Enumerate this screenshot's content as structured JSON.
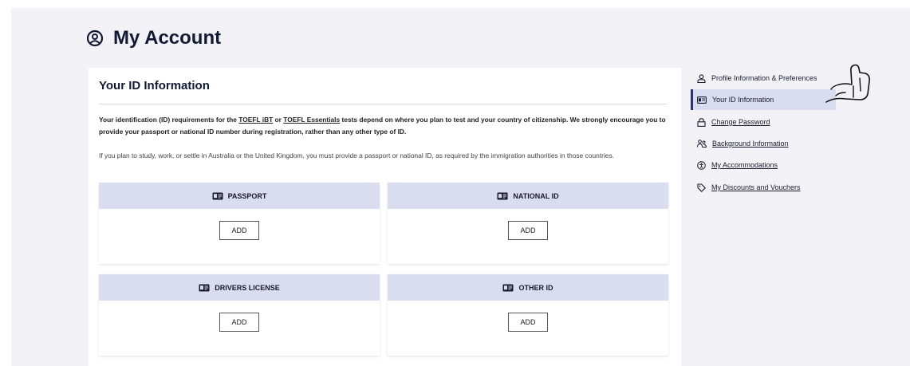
{
  "page": {
    "title": "My Account",
    "title_icon": "user-circle-icon"
  },
  "id_card": {
    "heading": "Your ID Information",
    "para1": {
      "before": "Your identification (ID) requirements for the ",
      "link1": "TOEFL iBT",
      "mid": " or ",
      "link2": "TOEFL Essentials",
      "after": " tests depend on where you plan to test and your country of citizenship. We strongly encourage you to provide your passport or national ID number during registration, rather than any other type of ID."
    },
    "para2": "If you plan to study, work, or settle in Australia or the United Kingdom, you must provide a passport or national ID, as required by the immigration authorities in those countries.",
    "id_types": [
      {
        "label": "PASSPORT",
        "button": "ADD"
      },
      {
        "label": "NATIONAL ID",
        "button": "ADD"
      },
      {
        "label": "DRIVERS LICENSE",
        "button": "ADD"
      },
      {
        "label": "OTHER ID",
        "button": "ADD"
      }
    ]
  },
  "sidebar": {
    "items": [
      {
        "label": "Profile Information & Preferences",
        "icon": "person-icon",
        "active": false,
        "underlined": false
      },
      {
        "label": "Your ID Information",
        "icon": "id-card-icon",
        "active": true,
        "underlined": false
      },
      {
        "label": "Change Password",
        "icon": "lock-icon",
        "active": false,
        "underlined": true
      },
      {
        "label": "Background Information",
        "icon": "people-icon",
        "active": false,
        "underlined": true
      },
      {
        "label": "My Accommodations",
        "icon": "accessibility-icon",
        "active": false,
        "underlined": true
      },
      {
        "label": "My Discounts and Vouchers",
        "icon": "tag-icon",
        "active": false,
        "underlined": true
      }
    ]
  },
  "colors": {
    "background": "#f3f3f7",
    "header_band": "#dadcf0",
    "active_accent": "#2c3278",
    "text": "#1a1a2e"
  }
}
